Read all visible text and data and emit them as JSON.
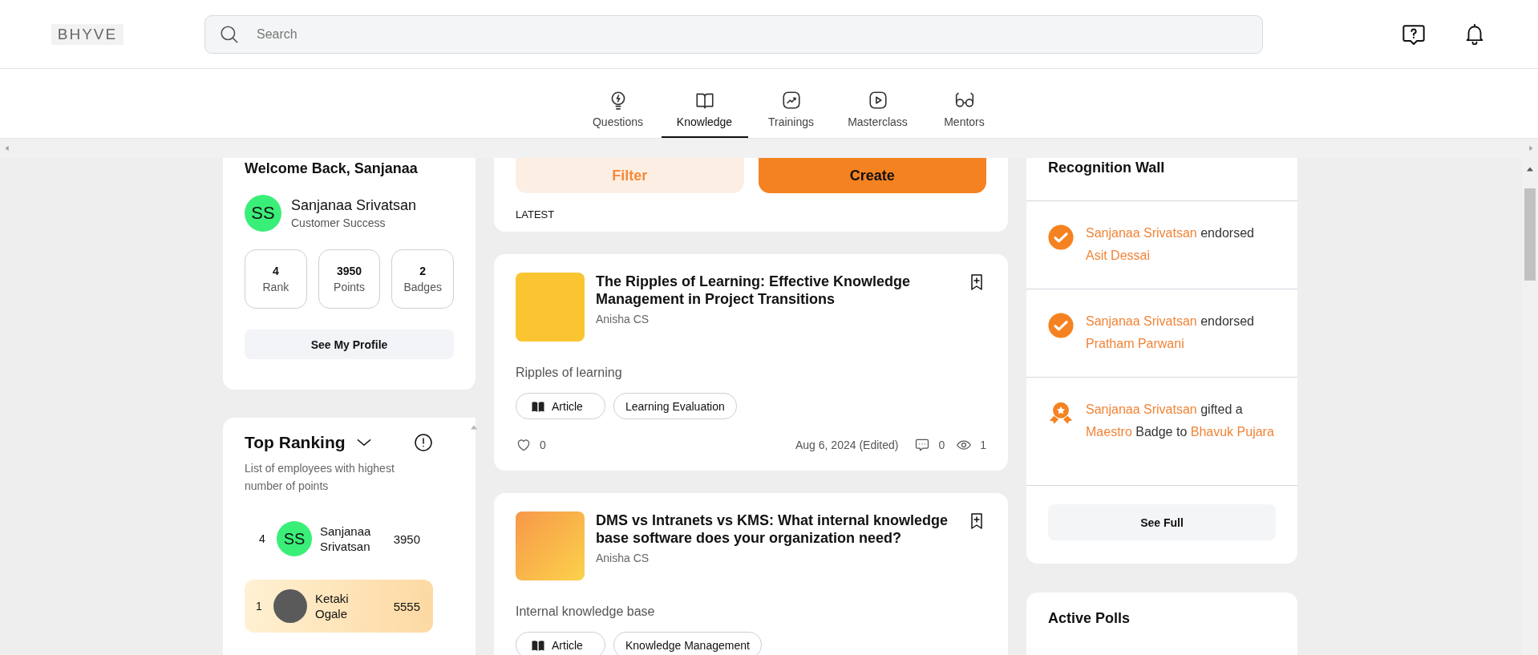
{
  "header": {
    "logo": "BHYVE",
    "search": {
      "placeholder": "Search"
    }
  },
  "nav_tabs": [
    {
      "label": "Questions",
      "selected": false
    },
    {
      "label": "Knowledge",
      "selected": true
    },
    {
      "label": "Trainings",
      "selected": false
    },
    {
      "label": "Masterclass",
      "selected": false
    },
    {
      "label": "Mentors",
      "selected": false
    }
  ],
  "welcome_card": {
    "title": "Welcome Back, Sanjanaa",
    "user": {
      "initials": "SS",
      "name": "Sanjanaa Srivatsan",
      "role": "Customer Success"
    },
    "stats": [
      {
        "value": "4",
        "label": "Rank"
      },
      {
        "value": "3950",
        "label": "Points"
      },
      {
        "value": "2",
        "label": "Badges"
      }
    ],
    "button": "See My Profile"
  },
  "top_ranking": {
    "title": "Top Ranking",
    "description": "List of employees with highest number of points",
    "rows": [
      {
        "rank": "4",
        "kind": "initials",
        "initials": "SS",
        "name": "Sanjanaa Srivatsan",
        "points": "3950",
        "highlighted": false
      },
      {
        "rank": "1",
        "kind": "photo",
        "name": "Ketaki Ogale",
        "points": "5555",
        "highlighted": true
      }
    ]
  },
  "actions": {
    "filter": "Filter",
    "create": "Create",
    "section_label": "LATEST"
  },
  "posts": [
    {
      "title": "The Ripples of Learning: Effective Knowledge Management in Project Transitions",
      "author": "Anisha CS",
      "description": "Ripples of learning",
      "type": "Article",
      "tag": "Learning Evaluation",
      "likes": "0",
      "date": "Aug 6, 2024 (Edited)",
      "comments": "0",
      "views": "1"
    },
    {
      "title": "DMS vs Intranets vs KMS: What internal knowledge base software does your organization need?",
      "author": "Anisha CS",
      "description": "Internal knowledge base",
      "type": "Article",
      "tag": "Knowledge Management"
    }
  ],
  "recognition_wall": {
    "title": "Recognition Wall",
    "entries": [
      {
        "kind": "endorse",
        "parts": [
          {
            "kind": "link",
            "text": "Sanjanaa Srivatsan"
          },
          {
            "kind": "text",
            "text": " endorsed "
          },
          {
            "kind": "link",
            "text": "Asit Dessai"
          }
        ]
      },
      {
        "kind": "endorse",
        "parts": [
          {
            "kind": "link",
            "text": "Sanjanaa Srivatsan"
          },
          {
            "kind": "text",
            "text": " endorsed "
          },
          {
            "kind": "link",
            "text": "Pratham Parwani"
          }
        ]
      },
      {
        "kind": "gift",
        "parts": [
          {
            "kind": "link",
            "text": "Sanjanaa Srivatsan"
          },
          {
            "kind": "text",
            "text": " gifted a "
          },
          {
            "kind": "link",
            "text": "Maestro"
          },
          {
            "kind": "text",
            "text": " Badge to "
          },
          {
            "kind": "link",
            "text": "Bhavuk Pujara"
          }
        ]
      }
    ],
    "button": "See Full"
  },
  "active_polls": {
    "title": "Active Polls"
  }
}
